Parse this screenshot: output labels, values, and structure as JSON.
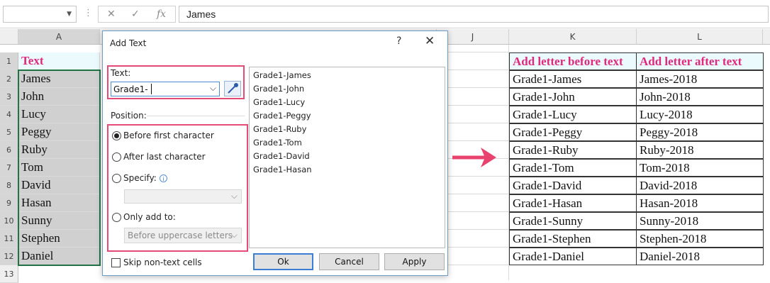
{
  "formula_bar": {
    "name_box": "",
    "value": "James",
    "cancel_icon": "✕",
    "enter_icon": "✓",
    "fx_label": "fx"
  },
  "columns": [
    "A",
    "J",
    "K",
    "L"
  ],
  "rows": [
    "1",
    "2",
    "3",
    "4",
    "5",
    "6",
    "7",
    "8",
    "9",
    "10",
    "11",
    "12",
    "13"
  ],
  "left_column": {
    "header": "Text",
    "values": [
      "James",
      "John",
      "Lucy",
      "Peggy",
      "Ruby",
      "Tom",
      "David",
      "Hasan",
      "Sunny",
      "Stephen",
      "Daniel"
    ]
  },
  "result_table": {
    "headers": [
      "Add letter before text",
      "Add letter after text"
    ],
    "before": [
      "Grade1-James",
      "Grade1-John",
      "Grade1-Lucy",
      "Grade1-Peggy",
      "Grade1-Ruby",
      "Grade1-Tom",
      "Grade1-David",
      "Grade1-Hasan",
      "Grade1-Sunny",
      "Grade1-Stephen",
      "Grade1-Daniel"
    ],
    "after": [
      "James-2018",
      "John-2018",
      "Lucy-2018",
      "Peggy-2018",
      "Ruby-2018",
      "Tom-2018",
      "David-2018",
      "Hasan-2018",
      "Sunny-2018",
      "Stephen-2018",
      "Daniel-2018"
    ]
  },
  "dialog": {
    "title": "Add Text",
    "help": "?",
    "close": "✕",
    "text_label": "Text:",
    "text_value": "Grade1-",
    "position_label": "Position:",
    "options": {
      "before_first": "Before first character",
      "after_last": "After last character",
      "specify": "Specify:",
      "only_add_to": "Only add to:"
    },
    "selected_option": "before_first",
    "only_add_to_value": "Before uppercase letters",
    "preview": [
      "Grade1-James",
      "Grade1-John",
      "Grade1-Lucy",
      "Grade1-Peggy",
      "Grade1-Ruby",
      "Grade1-Tom",
      "Grade1-David",
      "Grade1-Hasan"
    ],
    "skip_non_text": "Skip non-text cells",
    "buttons": {
      "ok": "Ok",
      "cancel": "Cancel",
      "apply": "Apply"
    }
  },
  "colors": {
    "accent_pink": "#e0287e",
    "highlight_box": "#e44b76",
    "arrow": "#e8436f",
    "header_fill": "#ebfbfd"
  }
}
